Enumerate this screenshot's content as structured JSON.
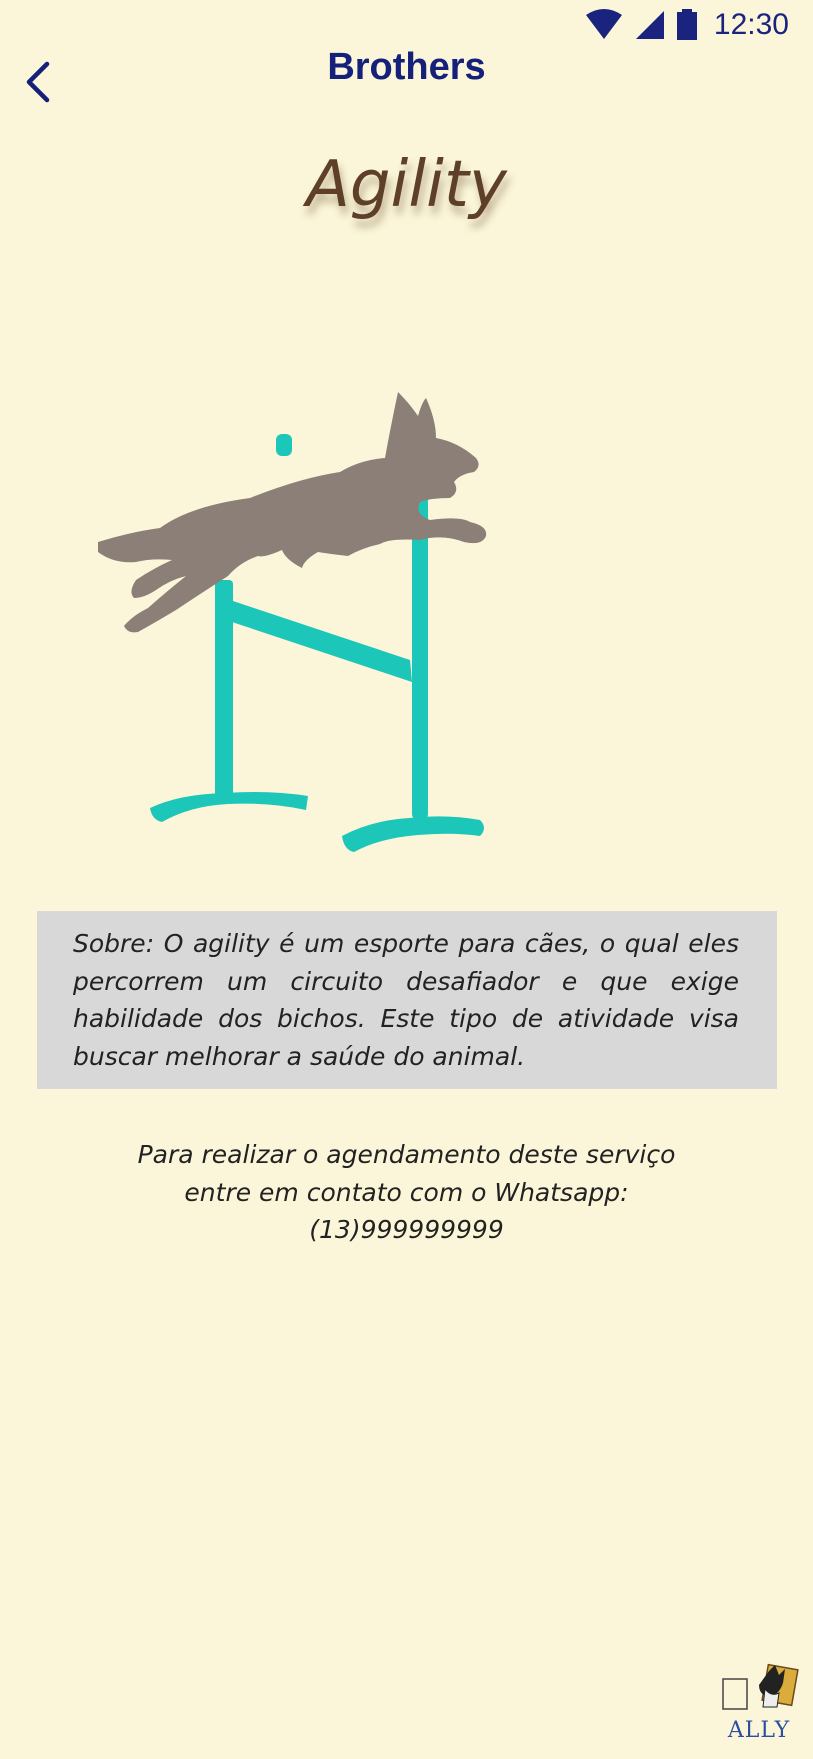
{
  "status_bar": {
    "time": "12:30",
    "icons": [
      "wifi-icon",
      "signal-icon",
      "battery-icon"
    ]
  },
  "app_bar": {
    "title": "Brothers",
    "back_icon": "chevron-left-icon"
  },
  "page": {
    "heading": "Agility",
    "image_subject": "dog-jumping-hurdle",
    "about_text": "Sobre: O agility é um esporte para cães, o qual eles percorrem um circuito desafiador e que exige habilidade dos bichos. Este tipo de atividade visa buscar melhorar a saúde do animal.",
    "contact_line_1": "Para realizar o agendamento deste serviço",
    "contact_line_2": "entre em contato com o Whatsapp:",
    "contact_phone": "(13)999999999"
  },
  "brand": {
    "logo_text": "ALLY"
  },
  "colors": {
    "background": "#fbf6d9",
    "accent": "#14207a",
    "heading": "#5e3f27",
    "dog": "#8b7f78",
    "hurdle": "#1cc6b8",
    "about_box": "#d8d8d8"
  }
}
